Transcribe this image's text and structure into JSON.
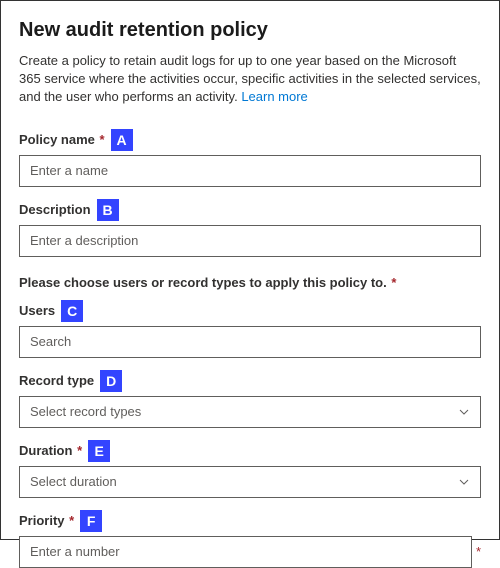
{
  "title": "New audit retention policy",
  "intro": "Create a policy to retain audit logs for up to one year based on the Microsoft 365 service where the activities occur, specific activities in the selected services, and the user who performs an activity. ",
  "learn_more": "Learn more",
  "policy_name": {
    "label": "Policy name",
    "marker": "A",
    "placeholder": "Enter a name"
  },
  "description": {
    "label": "Description",
    "marker": "B",
    "placeholder": "Enter a description"
  },
  "section_text": "Please choose users or record types to apply this policy to.",
  "users": {
    "label": "Users",
    "marker": "C",
    "placeholder": "Search"
  },
  "record_type": {
    "label": "Record type",
    "marker": "D",
    "placeholder": "Select record types"
  },
  "duration": {
    "label": "Duration",
    "marker": "E",
    "placeholder": "Select duration"
  },
  "priority": {
    "label": "Priority",
    "marker": "F",
    "placeholder": "Enter a number"
  }
}
